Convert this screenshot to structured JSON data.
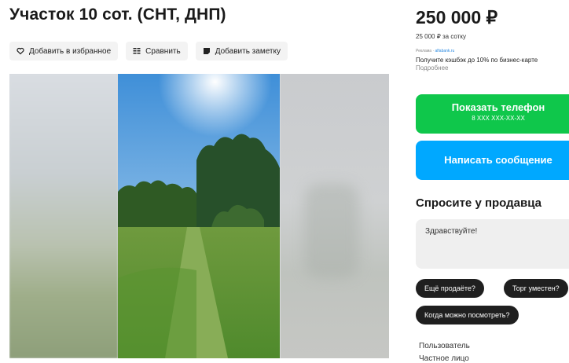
{
  "listing": {
    "title": "Участок 10 сот. (СНТ, ДНП)",
    "actions": {
      "favorite": "Добавить в избранное",
      "compare": "Сравнить",
      "note": "Добавить заметку"
    }
  },
  "price": {
    "value": "250 000 ₽",
    "per_sotka": "25 000 ₽ за сотку"
  },
  "ad": {
    "label": "Реклама ·",
    "domain": "alfabank.ru",
    "text": "Получите кэшбэк до 10% по бизнес-карте",
    "more": "Подробнее"
  },
  "buttons": {
    "show_phone": "Показать телефон",
    "phone_mask": "8 XXX XXX-XX-XX",
    "write_message": "Написать сообщение"
  },
  "ask_seller": {
    "title": "Спросите у продавца",
    "message": "Здравствуйте!",
    "quick_questions": [
      "Ещё продаёте?",
      "Торг уместен?",
      "Когда можно посмотреть?"
    ]
  },
  "seller": {
    "label": "Пользователь",
    "type": "Частное лицо"
  },
  "colors": {
    "green": "#0fc74b",
    "blue": "#00a8ff",
    "chip": "#1f1f1f"
  }
}
